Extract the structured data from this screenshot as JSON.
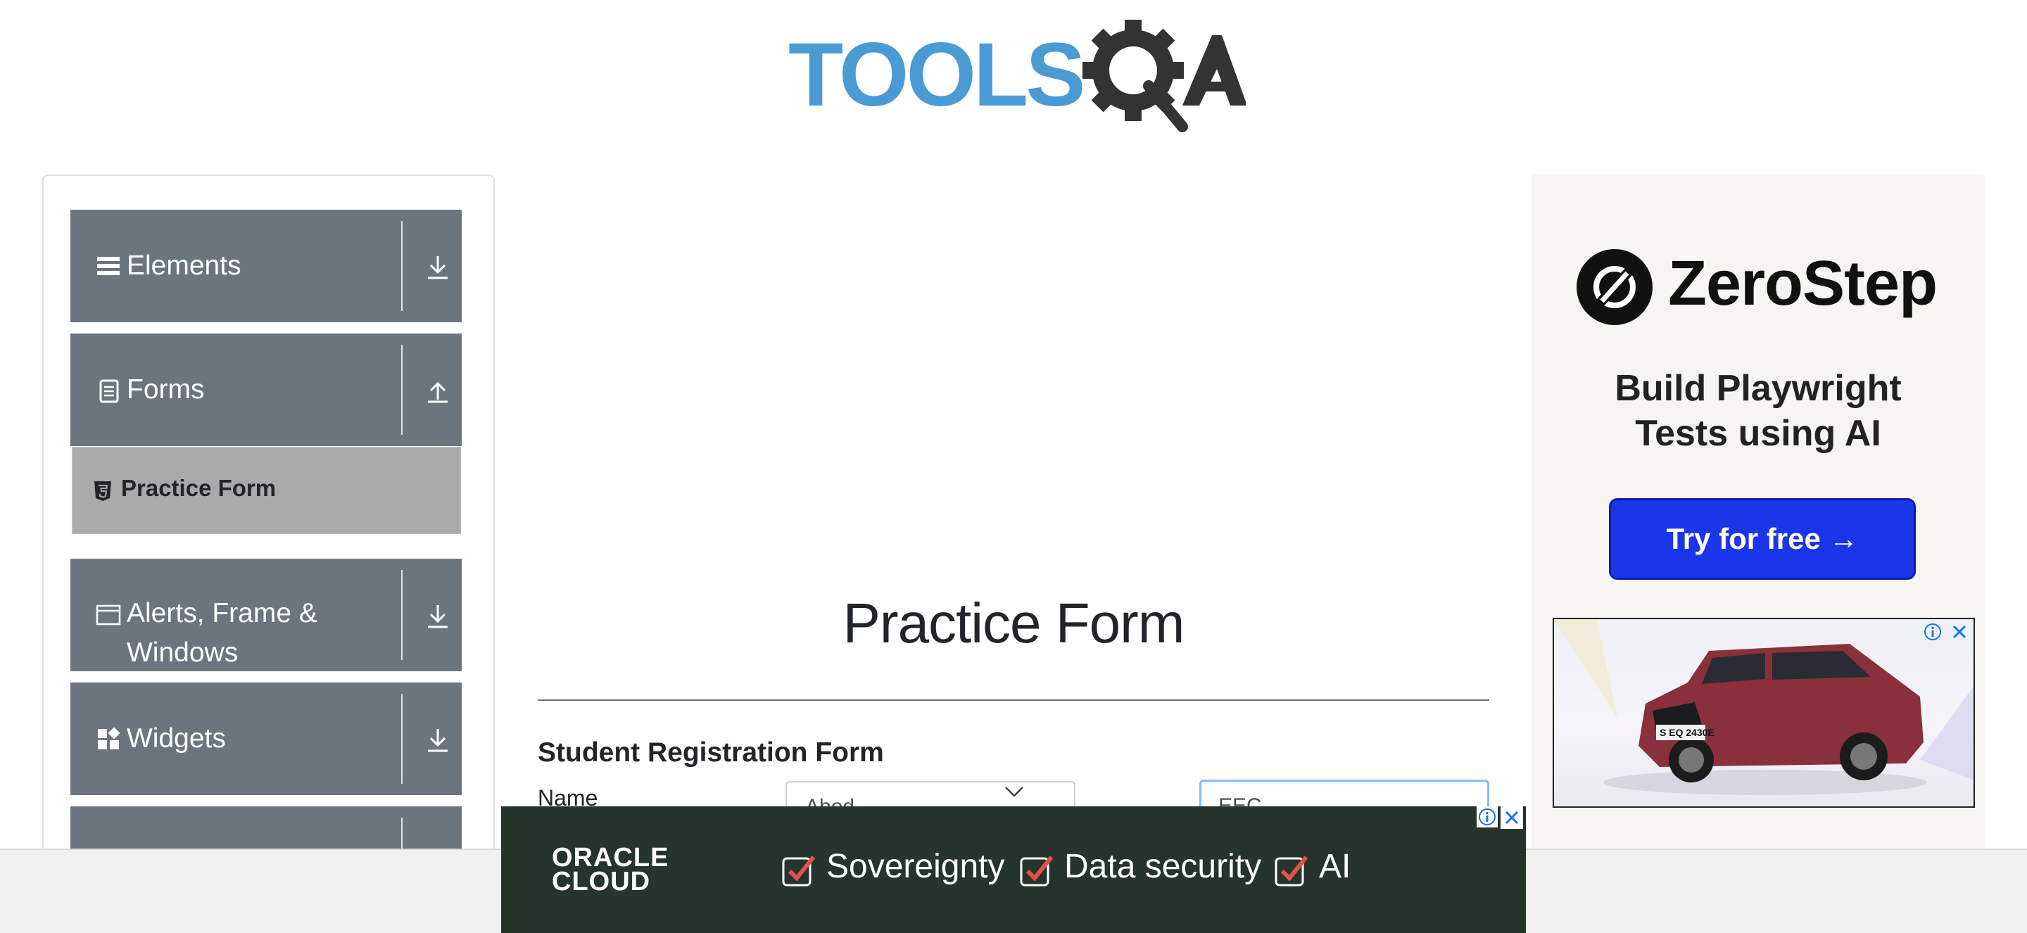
{
  "header": {
    "logo_text": "TOOLSQA"
  },
  "sidebar": {
    "groups": [
      {
        "label": "Elements",
        "icon": "hamburger-icon",
        "arrow": "download-arrow"
      },
      {
        "label": "Forms",
        "icon": "document-icon",
        "arrow": "upload-arrow"
      },
      {
        "label": "Alerts, Frame &",
        "label2": "Windows",
        "icon": "window-icon",
        "arrow": "download-arrow"
      },
      {
        "label": "Widgets",
        "icon": "widgets-icon",
        "arrow": "download-arrow"
      }
    ],
    "active_item": {
      "label": "Practice Form",
      "icon": "html5-icon"
    }
  },
  "main": {
    "title": "Practice Form",
    "form_title": "Student Registration Form",
    "name_label": "Name",
    "first_name_value": "Abod",
    "last_name_value": "EEC"
  },
  "ad_right": {
    "brand": "ZeroStep",
    "tagline_line1": "Build Playwright",
    "tagline_line2": "Tests using AI",
    "button": "Try for free →",
    "car_plate": "S EQ 2430E"
  },
  "ad_bottom": {
    "logo_line1": "ORACLE",
    "logo_line2": "CLOUD",
    "items": [
      "Sovereignty",
      "Data security",
      "AI"
    ]
  },
  "colors": {
    "sidebar_group_bg": "#6c757d",
    "active_item_bg": "#aaaaaa",
    "brand_blue": "#4a9bd4",
    "cta_blue": "#1a36e8",
    "oracle_bg": "#27342c",
    "check_red": "#e0524b"
  }
}
